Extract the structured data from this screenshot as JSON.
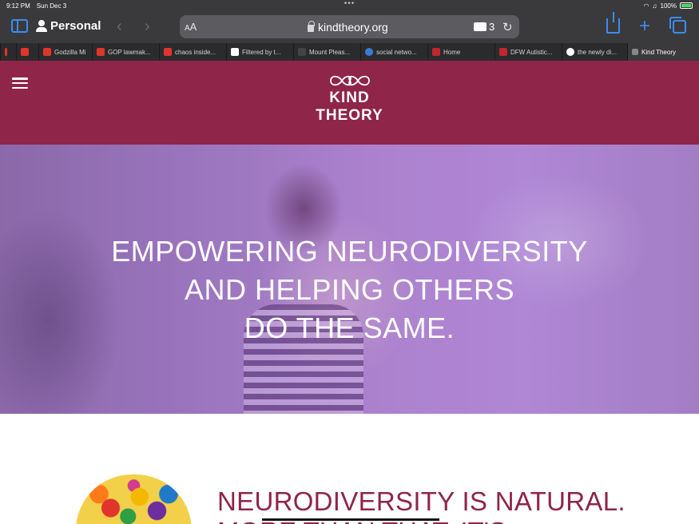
{
  "status_bar": {
    "time": "9:12 PM",
    "date": "Sun Dec 3",
    "battery": "100%"
  },
  "toolbar": {
    "profile_label": "Personal",
    "aa_label": "AA",
    "url": "kindtheory.org",
    "extensions_count": "3"
  },
  "tabs": [
    {
      "title": "",
      "favicon_color": "#e0352b"
    },
    {
      "title": "",
      "favicon_color": "#e0352b"
    },
    {
      "title": "Godzilla Mi",
      "favicon_color": "#e0352b"
    },
    {
      "title": "GOP lawmak...",
      "favicon_color": "#e0352b"
    },
    {
      "title": "chaos inside...",
      "favicon_color": "#e0352b"
    },
    {
      "title": "Filtered by t...",
      "favicon_color": "#ffffff"
    },
    {
      "title": "Mount Pleas...",
      "favicon_color": "#444444"
    },
    {
      "title": "social netwo...",
      "favicon_color": "#3b7bd4"
    },
    {
      "title": "Home",
      "favicon_color": "#c0262e"
    },
    {
      "title": "DFW Autistic...",
      "favicon_color": "#c0262e"
    },
    {
      "title": "the newly di...",
      "favicon_color": "#ffffff"
    },
    {
      "title": "Kind Theory",
      "favicon_color": "#888888"
    }
  ],
  "site": {
    "brand_color": "#8f2548",
    "logo_line1": "KIND",
    "logo_line2": "THEORY",
    "hero_line1": "EMPOWERING NEURODIVERSITY",
    "hero_line2": "AND HELPING OTHERS",
    "hero_line3": "DO THE SAME.",
    "section_heading": "NEURODIVERSITY IS NATURAL.",
    "section_heading_cut": "MORE THAN THAT, IT'S"
  }
}
